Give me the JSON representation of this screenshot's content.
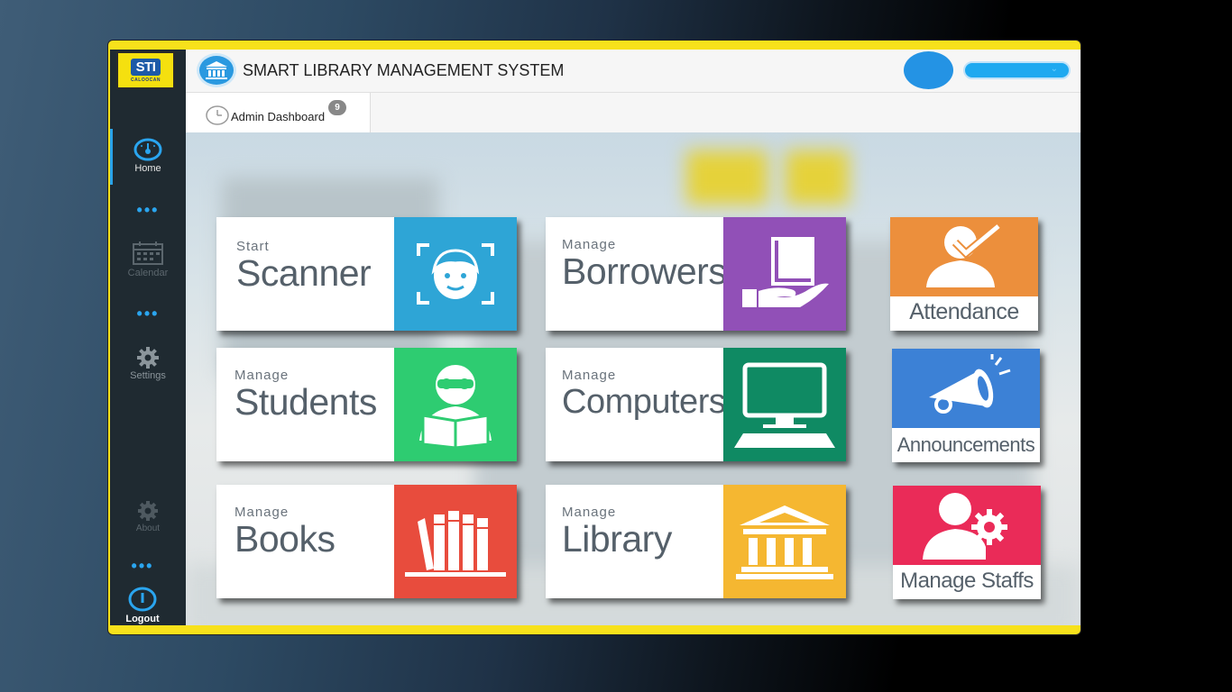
{
  "app": {
    "title": "SMART LIBRARY MANAGEMENT SYSTEM",
    "logo_text": "STI",
    "logo_sub": "CALOOCAN"
  },
  "sidebar": {
    "items": [
      {
        "label": "Home",
        "icon": "gauge-icon",
        "active": true
      },
      {
        "label": "Calendar",
        "icon": "calendar-icon",
        "active": false
      },
      {
        "label": "Settings",
        "icon": "gear-icon",
        "active": false
      },
      {
        "label": "About",
        "icon": "about-icon",
        "active": false
      },
      {
        "label": "Logout",
        "icon": "power-icon",
        "active": false
      }
    ]
  },
  "tab": {
    "label": "Admin Dashboard",
    "badge": "9"
  },
  "tiles": [
    {
      "small": "Start",
      "big": "Scanner",
      "color": "#2ea5d6",
      "icon": "face-scan-icon"
    },
    {
      "small": "Manage",
      "big": "Borrowers",
      "color": "#9150b7",
      "icon": "book-hand-icon"
    },
    {
      "small": "Manage",
      "big": "Students",
      "color": "#2ecc71",
      "icon": "student-reading-icon"
    },
    {
      "small": "Manage",
      "big": "Computers",
      "color": "#0f8a63",
      "icon": "computer-icon"
    },
    {
      "small": "Manage",
      "big": "Books",
      "color": "#e84c3d",
      "icon": "books-icon"
    },
    {
      "small": "Manage",
      "big": "Library",
      "color": "#f5b731",
      "icon": "library-building-icon"
    }
  ],
  "squares": [
    {
      "label": "Attendance",
      "color": "#ec8f3c",
      "icon": "attendance-check-icon"
    },
    {
      "label": "Announcements",
      "color": "#3c81d6",
      "icon": "megaphone-icon"
    },
    {
      "label": "Manage Staffs",
      "color": "#ea2b58",
      "icon": "staff-gear-icon"
    }
  ],
  "colors": {
    "frame": "#f7e11b",
    "sidebar": "#1f2a31",
    "accent": "#2a99e0"
  }
}
